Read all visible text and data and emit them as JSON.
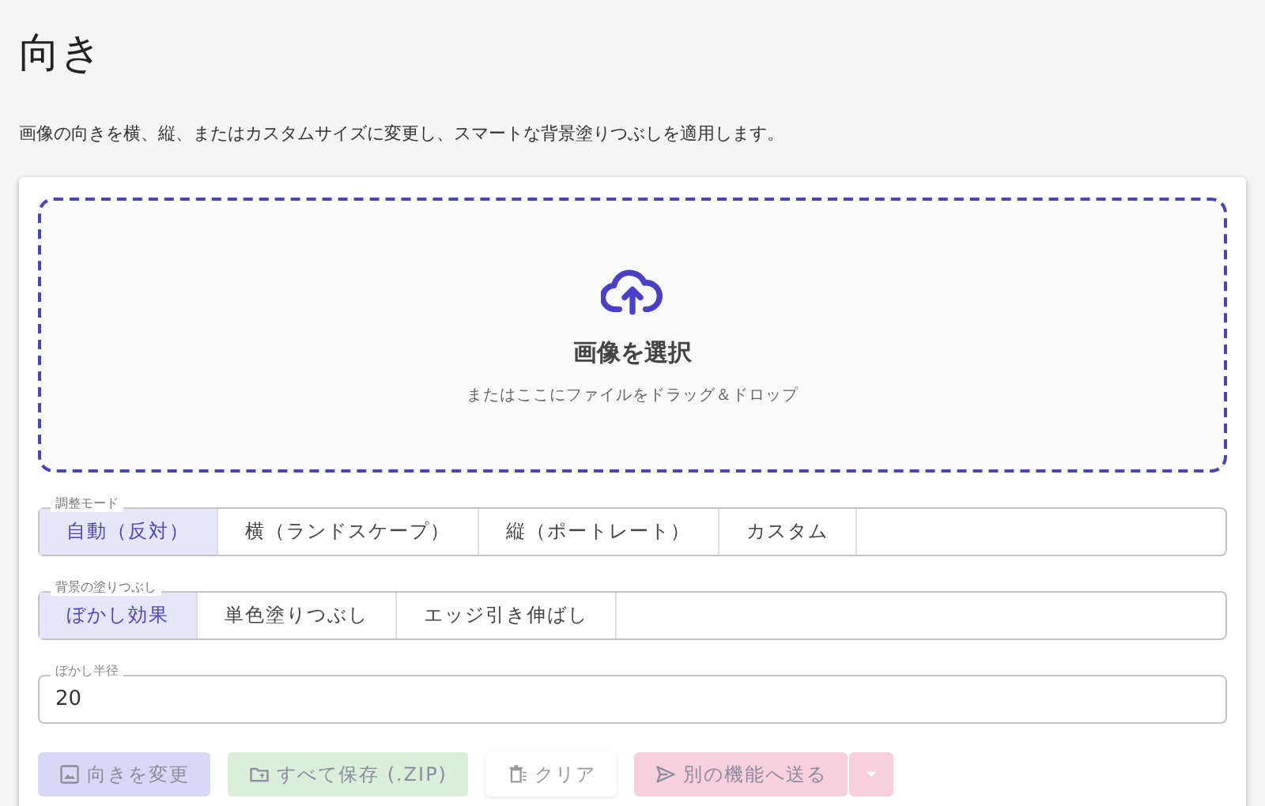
{
  "title": "向き",
  "description": "画像の向きを横、縦、またはカスタムサイズに変更し、スマートな背景塗りつぶしを適用します。",
  "dropzone": {
    "title": "画像を選択",
    "hint": "またはここにファイルをドラッグ＆ドロップ"
  },
  "groups": [
    {
      "label": "調整モード",
      "options": [
        {
          "label": "自動（反対）",
          "selected": true
        },
        {
          "label": "横（ランドスケープ）",
          "selected": false
        },
        {
          "label": "縦（ポートレート）",
          "selected": false
        },
        {
          "label": "カスタム",
          "selected": false
        }
      ]
    },
    {
      "label": "背景の塗りつぶし",
      "options": [
        {
          "label": "ぼかし効果",
          "selected": true
        },
        {
          "label": "単色塗りつぶし",
          "selected": false
        },
        {
          "label": "エッジ引き伸ばし",
          "selected": false
        }
      ]
    }
  ],
  "field": {
    "label": "ぼかし半径",
    "value": "20"
  },
  "actions": [
    {
      "kind": "image",
      "label": "向きを変更",
      "color": "#d9d7f6",
      "disabled": true
    },
    {
      "kind": "folder",
      "label": "すべて保存 (.ZIP)",
      "color": "#d9eedb",
      "disabled": true
    },
    {
      "kind": "trash",
      "label": "クリア",
      "disabled": true
    },
    {
      "kind": "send",
      "label": "別の機能へ送る",
      "color": "#f8d0dd",
      "disabled": true,
      "dropdown": true
    }
  ]
}
